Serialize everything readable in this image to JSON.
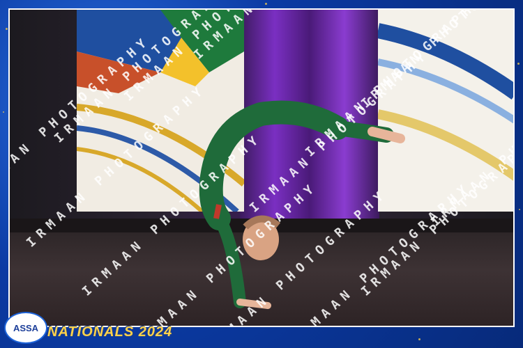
{
  "watermark": {
    "text": "IRMAAN PHOTOGRAPHY"
  },
  "logo": {
    "text": "ASSA"
  },
  "event": {
    "title": "NATIONALS 2024"
  },
  "colors": {
    "frame_blue": "#0b3aa3",
    "leotard_green": "#1f6b3a",
    "gold": "#ffd24a"
  }
}
